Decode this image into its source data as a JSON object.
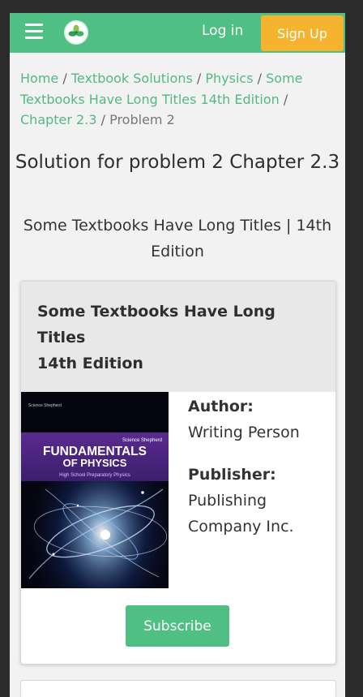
{
  "nav": {
    "login_label": "Log in",
    "signup_label": "Sign Up",
    "colors": {
      "nav_bg": "#4fbf84",
      "signup_bg": "#f5b32f"
    }
  },
  "breadcrumb": {
    "items": [
      "Home",
      "Textbook Solutions",
      "Physics",
      "Some Textbooks Have Long Titles 14th Edition",
      "Chapter 2.3"
    ],
    "current": "Problem 2",
    "separator": "/"
  },
  "page": {
    "title": "Solution for problem 2 Chapter 2.3",
    "subtitle": "Some Textbooks Have Long Titles | 14th Edition"
  },
  "book": {
    "title_line1": "Some Textbooks Have Long Titles",
    "title_line2": "14th Edition",
    "author_label": "Author:",
    "author": "Writing Person",
    "publisher_label": "Publisher:",
    "publisher": "Publishing Company Inc.",
    "cover": {
      "corner_text": "Science Shepherd",
      "series": "Science Shepherd",
      "title_line1": "FUNDAMENTALS",
      "title_line2": "OF PHYSICS",
      "subtitle": "High School Preparatory Physics"
    },
    "subscribe_label": "Subscribe"
  }
}
